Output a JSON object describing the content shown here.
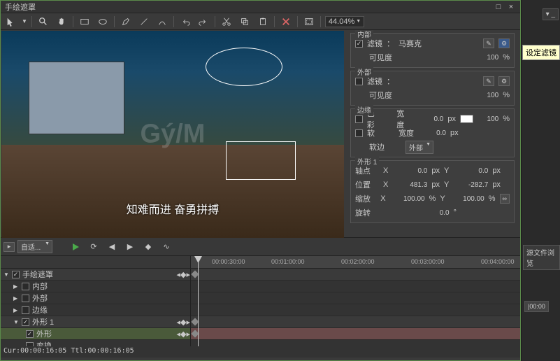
{
  "window": {
    "title": "手绘遮罩"
  },
  "toolbar": {
    "zoom": "44.04%"
  },
  "preview": {
    "caption": "知难而进 奋勇拼搏"
  },
  "tooltip": "设定滤镜",
  "props": {
    "inner": {
      "title": "内部",
      "filter_label": "滤镜",
      "filter_value": "马赛克",
      "visibility_label": "可见度",
      "visibility_value": "100",
      "visibility_unit": "%"
    },
    "outer": {
      "title": "外部",
      "filter_label": "滤镜",
      "visibility_label": "可见度",
      "visibility_value": "100",
      "visibility_unit": "%"
    },
    "edge": {
      "title": "边缘",
      "color_label": "色彩",
      "soft_label": "软",
      "width_label": "宽度",
      "width1": "0.0",
      "width2": "0.0",
      "unit_px": "px",
      "pct": "100",
      "unit_pct": "%",
      "softedge_label": "软边",
      "softedge_value": "外部"
    },
    "shape": {
      "title": "外形 1",
      "anchor_label": "轴点",
      "position_label": "位置",
      "scale_label": "缩放",
      "rotation_label": "旋转",
      "x_label": "X",
      "y_label": "Y",
      "anchor_x": "0.0",
      "anchor_y": "0.0",
      "pos_x": "481.3",
      "pos_y": "-282.7",
      "scale_x": "100.00",
      "scale_y": "100.00",
      "rotation": "0.0",
      "unit_px": "px",
      "unit_pct": "%",
      "unit_deg": "°"
    }
  },
  "timeline": {
    "fit_label": "自适...",
    "ruler": [
      "00:00:30:00",
      "00:01:00:00",
      "00:02:00:00",
      "00:03:00:00",
      "00:04:00:00"
    ],
    "tracks": {
      "root": "手绘遮罩",
      "inner": "内部",
      "outer": "外部",
      "edge": "边缘",
      "shape1": "外形 1",
      "shape": "外形",
      "transform": "变换"
    },
    "status": "Cur:00:00:16:05 Ttl:00:00:16:05"
  },
  "side": {
    "tab1": "源文件浏览",
    "time": "|00:00"
  }
}
